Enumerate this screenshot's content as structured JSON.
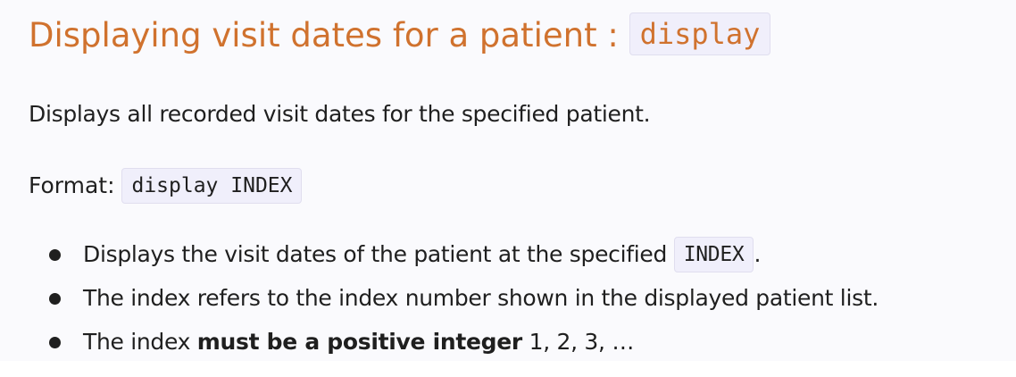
{
  "heading": {
    "text": "Displaying visit dates for a patient : ",
    "code": "display"
  },
  "description": "Displays all recorded visit dates for the specified patient.",
  "format": {
    "label": "Format: ",
    "code": "display INDEX"
  },
  "bullets": [
    {
      "before": "Displays the visit dates of the patient at the specified ",
      "code": "INDEX",
      "after": "."
    },
    {
      "text": "The index refers to the index number shown in the displayed patient list."
    },
    {
      "before": "The index ",
      "bold": "must be a positive integer",
      "after": " 1, 2, 3, …"
    }
  ]
}
